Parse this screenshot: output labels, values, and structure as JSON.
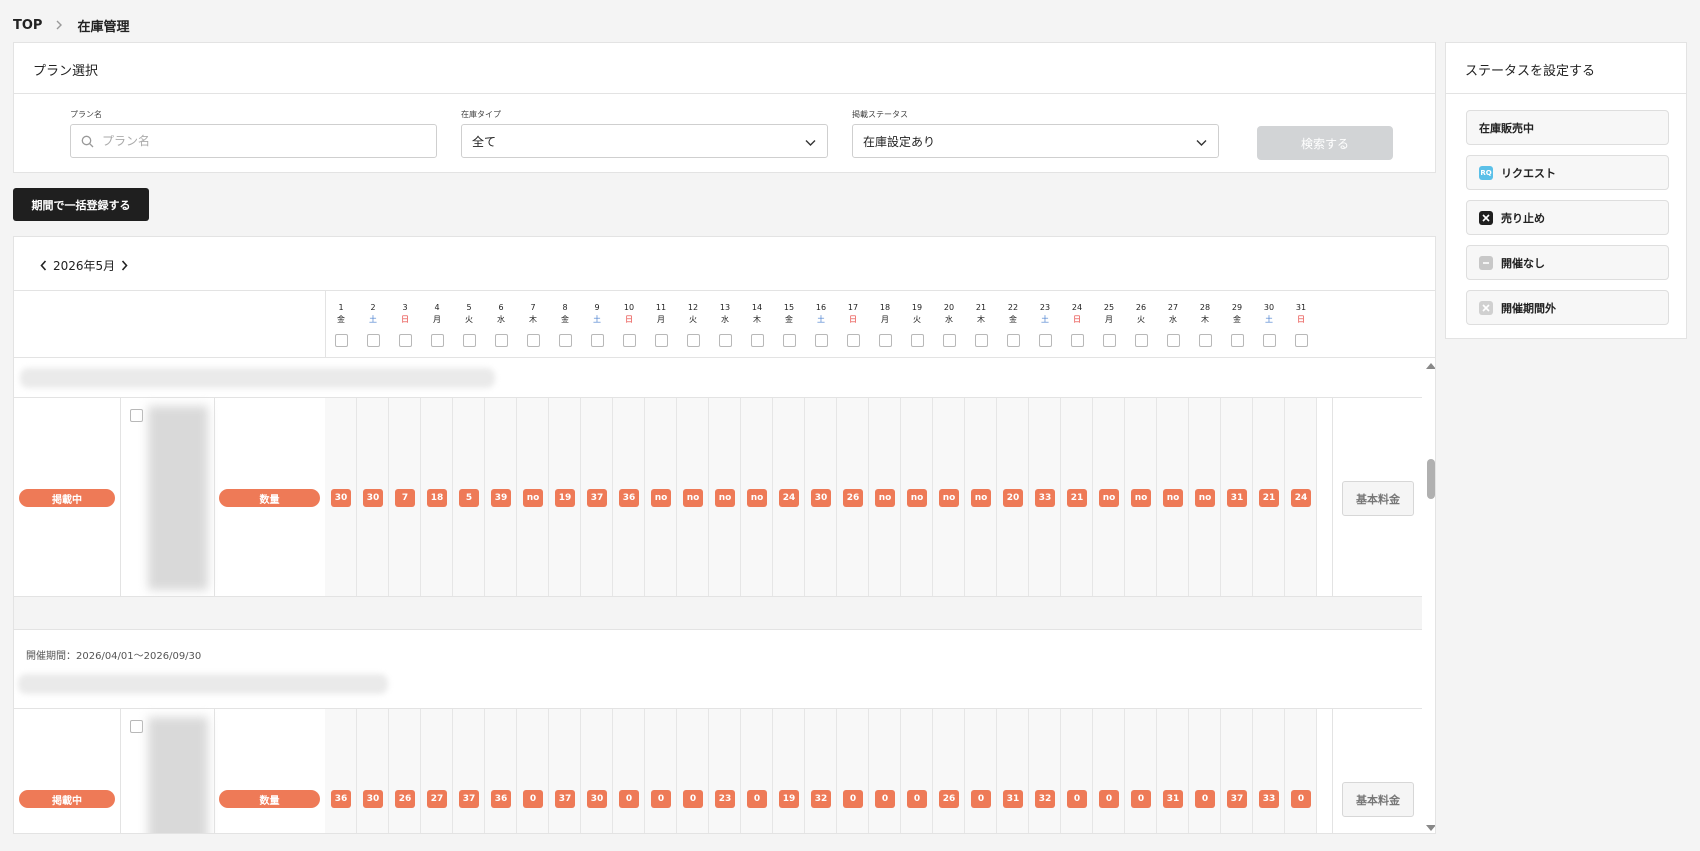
{
  "breadcrumb": {
    "home": "TOP",
    "current": "在庫管理"
  },
  "plan_select": {
    "title": "プラン選択",
    "plan_name": {
      "label": "プラン名",
      "placeholder": "プラン名",
      "value": ""
    },
    "stock_type": {
      "label": "在庫タイプ",
      "value": "全て"
    },
    "publish_status": {
      "label": "掲載ステータス",
      "value": "在庫設定あり"
    },
    "search_button": "検索する"
  },
  "bulk_register_button": "期間で一括登録する",
  "calendar": {
    "month_label": "2026年5月",
    "days": [
      {
        "d": "1",
        "w": "金"
      },
      {
        "d": "2",
        "w": "土"
      },
      {
        "d": "3",
        "w": "日"
      },
      {
        "d": "4",
        "w": "月"
      },
      {
        "d": "5",
        "w": "火"
      },
      {
        "d": "6",
        "w": "水"
      },
      {
        "d": "7",
        "w": "木"
      },
      {
        "d": "8",
        "w": "金"
      },
      {
        "d": "9",
        "w": "土"
      },
      {
        "d": "10",
        "w": "日"
      },
      {
        "d": "11",
        "w": "月"
      },
      {
        "d": "12",
        "w": "火"
      },
      {
        "d": "13",
        "w": "水"
      },
      {
        "d": "14",
        "w": "木"
      },
      {
        "d": "15",
        "w": "金"
      },
      {
        "d": "16",
        "w": "土"
      },
      {
        "d": "17",
        "w": "日"
      },
      {
        "d": "18",
        "w": "月"
      },
      {
        "d": "19",
        "w": "火"
      },
      {
        "d": "20",
        "w": "水"
      },
      {
        "d": "21",
        "w": "木"
      },
      {
        "d": "22",
        "w": "金"
      },
      {
        "d": "23",
        "w": "土"
      },
      {
        "d": "24",
        "w": "日"
      },
      {
        "d": "25",
        "w": "月"
      },
      {
        "d": "26",
        "w": "火"
      },
      {
        "d": "27",
        "w": "水"
      },
      {
        "d": "28",
        "w": "木"
      },
      {
        "d": "29",
        "w": "金"
      },
      {
        "d": "30",
        "w": "土"
      },
      {
        "d": "31",
        "w": "日"
      }
    ],
    "plans": [
      {
        "period": "",
        "status": "掲載中",
        "type": "数量",
        "price_button": "基本料金",
        "values": [
          "30",
          "30",
          "7",
          "18",
          "5",
          "39",
          "no",
          "19",
          "37",
          "36",
          "no",
          "no",
          "no",
          "no",
          "24",
          "30",
          "26",
          "no",
          "no",
          "no",
          "no",
          "20",
          "33",
          "21",
          "no",
          "no",
          "no",
          "no",
          "31",
          "21",
          "24"
        ]
      },
      {
        "period": "開催期間：2026/04/01〜2026/09/30",
        "status": "掲載中",
        "type": "数量",
        "price_button": "基本料金",
        "values": [
          "36",
          "30",
          "26",
          "27",
          "37",
          "36",
          "0",
          "37",
          "30",
          "0",
          "0",
          "0",
          "23",
          "0",
          "19",
          "32",
          "0",
          "0",
          "0",
          "26",
          "0",
          "31",
          "32",
          "0",
          "0",
          "0",
          "31",
          "0",
          "37",
          "33",
          "0"
        ]
      }
    ]
  },
  "status_panel": {
    "title": "ステータスを設定する",
    "buttons": [
      {
        "label": "在庫販売中",
        "icon": "none"
      },
      {
        "label": "リクエスト",
        "icon": "rq-icon",
        "icon_text": "RQ",
        "color": "#5bc0e8"
      },
      {
        "label": "売り止め",
        "icon": "close-icon",
        "color": "#1f1f1f"
      },
      {
        "label": "開催なし",
        "icon": "minus-icon",
        "color": "#c8c8c8"
      },
      {
        "label": "開催期間外",
        "icon": "close-icon",
        "color": "#d0d0d0"
      }
    ]
  },
  "colors": {
    "accent": "#ee7a57",
    "dark": "#1f1f1f",
    "saturday": "#4a7fcf",
    "sunday": "#e53935"
  }
}
